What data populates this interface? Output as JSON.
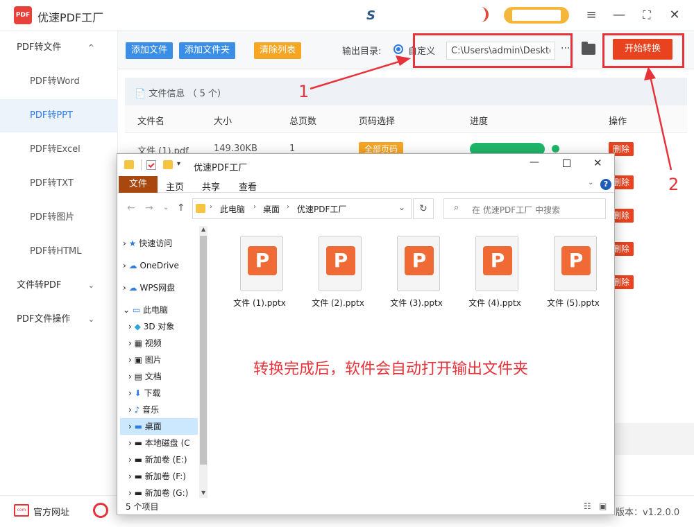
{
  "app": {
    "title": "优速PDF工厂",
    "logo_text": "PDF",
    "title_center": "S"
  },
  "window_controls": {
    "menu": "≡",
    "minimize": "—",
    "maximize": "⛶",
    "close": "✕"
  },
  "sidebar": {
    "groups": [
      {
        "label": "PDF转文件",
        "chev": "^"
      },
      {
        "label": "文件转PDF",
        "chev": "⌄"
      },
      {
        "label": "PDF文件操作",
        "chev": "⌄"
      }
    ],
    "items": [
      "PDF转Word",
      "PDF转PPT",
      "PDF转Excel",
      "PDF转TXT",
      "PDF转图片",
      "PDF转HTML"
    ]
  },
  "toolbar": {
    "add_file": "添加文件",
    "add_folder": "添加文件夹",
    "clear_list": "清除列表",
    "output_label": "输出目录:",
    "custom_label": "自定义",
    "path_value": "C:\\Users\\admin\\Deskto",
    "more": "···",
    "start": "开始转换"
  },
  "file_panel": {
    "title": "文件信息 （ 5 个）",
    "columns": [
      "文件名",
      "大小",
      "总页数",
      "页码选择",
      "进度",
      "操作"
    ],
    "row1": {
      "name": "文件 (1).pdf",
      "size": "149.30KB",
      "pages": "1",
      "page_sel": "全部页码",
      "progress": 1.0
    },
    "delete_label": "删除"
  },
  "annotations": {
    "one": "1",
    "two": "2",
    "note": "转换完成后，软件会自动打开输出文件夹"
  },
  "bottom": {
    "site": "官方网址",
    "site_icon": "com",
    "version": "版本：v1.2.0.0"
  },
  "explorer": {
    "title": "优速PDF工厂",
    "ribbon_tabs": [
      "文件",
      "主页",
      "共享",
      "查看"
    ],
    "address": [
      "此电脑",
      "桌面",
      "优速PDF工厂"
    ],
    "search_placeholder": "在 优速PDF工厂 中搜索",
    "nav": [
      "快速访问",
      "OneDrive",
      "WPS网盘",
      "此电脑",
      "3D 对象",
      "视频",
      "图片",
      "文档",
      "下载",
      "音乐",
      "桌面",
      "本地磁盘 (C",
      "新加卷 (E:)",
      "新加卷 (F:)",
      "新加卷 (G:)"
    ],
    "files": [
      "文件 (1).pptx",
      "文件 (2).pptx",
      "文件 (3).pptx",
      "文件 (4).pptx",
      "文件 (5).pptx"
    ],
    "status": "5 个项目"
  },
  "colors": {
    "accent_blue": "#3a8ee6",
    "accent_orange": "#f6a623",
    "start_red": "#e8431e",
    "annotation_red": "#e8323a",
    "progress_green": "#1fb86b"
  }
}
